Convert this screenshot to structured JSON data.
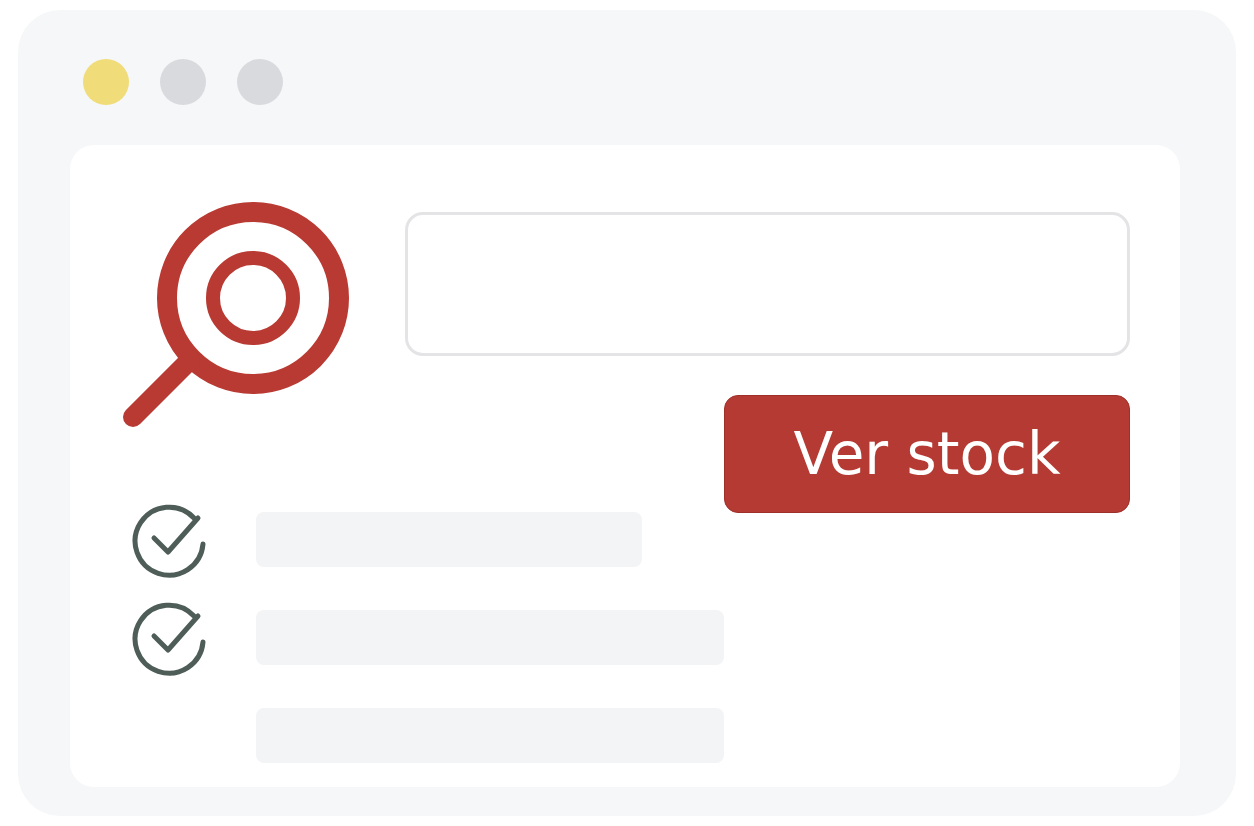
{
  "window": {
    "dots": [
      {
        "color": "#f0dc78"
      },
      {
        "color": "#d9dadd"
      },
      {
        "color": "#d9dadd"
      }
    ]
  },
  "search": {
    "button": "Ver stock"
  },
  "results": [
    {
      "checked": true,
      "kind": "short"
    },
    {
      "checked": true,
      "kind": "long"
    },
    {
      "checked": false,
      "kind": "long"
    }
  ]
}
